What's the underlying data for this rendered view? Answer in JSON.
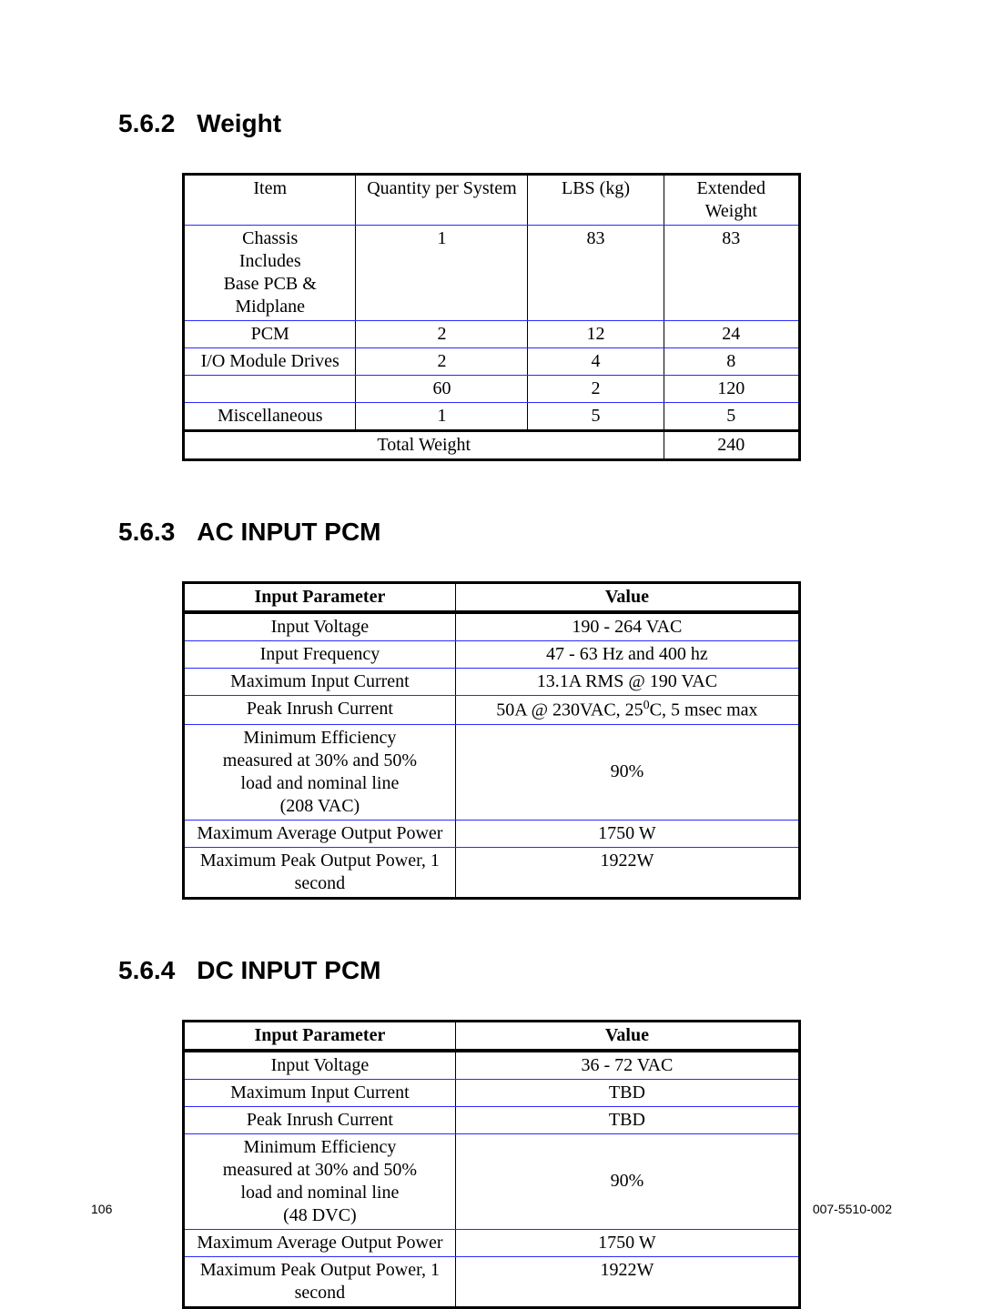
{
  "sections": {
    "weight": {
      "number": "5.6.2",
      "title": "Weight",
      "headers": {
        "c1": "Item",
        "c2": "Quantity per System",
        "c3": "LBS (kg)",
        "c4": "Extended Weight"
      },
      "rows": {
        "r0": {
          "item_l1": "Chassis",
          "item_l2": "Includes",
          "item_l3": "Base PCB & Midplane",
          "qty": "1",
          "lbs": "83",
          "ext": "83"
        },
        "r1": {
          "item": "PCM",
          "qty": "2",
          "lbs": "12",
          "ext": "24"
        },
        "r2": {
          "item": "I/O Module Drives",
          "qty": "2",
          "lbs": "4",
          "ext": "8"
        },
        "r3": {
          "item": "",
          "qty": "60",
          "lbs": "2",
          "ext": "120"
        },
        "r4": {
          "item": "Miscellaneous",
          "qty": "1",
          "lbs": "5",
          "ext": "5"
        }
      },
      "total_label": "Total Weight",
      "total_value": "240"
    },
    "ac": {
      "number": "5.6.3",
      "title": "AC INPUT PCM",
      "headers": {
        "p1": "Input Parameter",
        "p2": "Value"
      },
      "rows": {
        "r0": {
          "param": "Input Voltage",
          "value": "190 - 264 VAC"
        },
        "r1": {
          "param": "Input Frequency",
          "value": "47 - 63 Hz and 400 hz"
        },
        "r2": {
          "param": "Maximum Input Current",
          "value": "13.1A RMS @ 190 VAC"
        },
        "r3": {
          "param": "Peak Inrush Current",
          "value_pre": "50A @ 230VAC, 25",
          "value_deg": "0",
          "value_post": "C, 5 msec max"
        },
        "r4": {
          "param_l1": "Minimum Efficiency",
          "param_l2": "measured at 30% and 50%",
          "param_l3": "load and nominal line",
          "param_l4": "(208 VAC)",
          "value": "90%"
        },
        "r5": {
          "param": "Maximum Average Output Power",
          "value": "1750 W"
        },
        "r6": {
          "param": "Maximum Peak Output Power, 1 second",
          "value": "1922W"
        }
      }
    },
    "dc": {
      "number": "5.6.4",
      "title": "DC INPUT PCM",
      "headers": {
        "p1": "Input Parameter",
        "p2": "Value"
      },
      "rows": {
        "r0": {
          "param": "Input Voltage",
          "value": "36 - 72 VAC"
        },
        "r1": {
          "param": "Maximum Input Current",
          "value": "TBD"
        },
        "r2": {
          "param": "Peak Inrush Current",
          "value": "TBD"
        },
        "r3": {
          "param_l1": "Minimum Efficiency",
          "param_l2": "measured at 30% and 50%",
          "param_l3": "load and nominal line",
          "param_l4": "(48 DVC)",
          "value": "90%"
        },
        "r4": {
          "param": "Maximum Average Output Power",
          "value": "1750 W"
        },
        "r5": {
          "param": "Maximum Peak Output Power, 1 second",
          "value": "1922W"
        }
      }
    }
  },
  "footer": {
    "page": "106",
    "docid": "007-5510-002"
  }
}
